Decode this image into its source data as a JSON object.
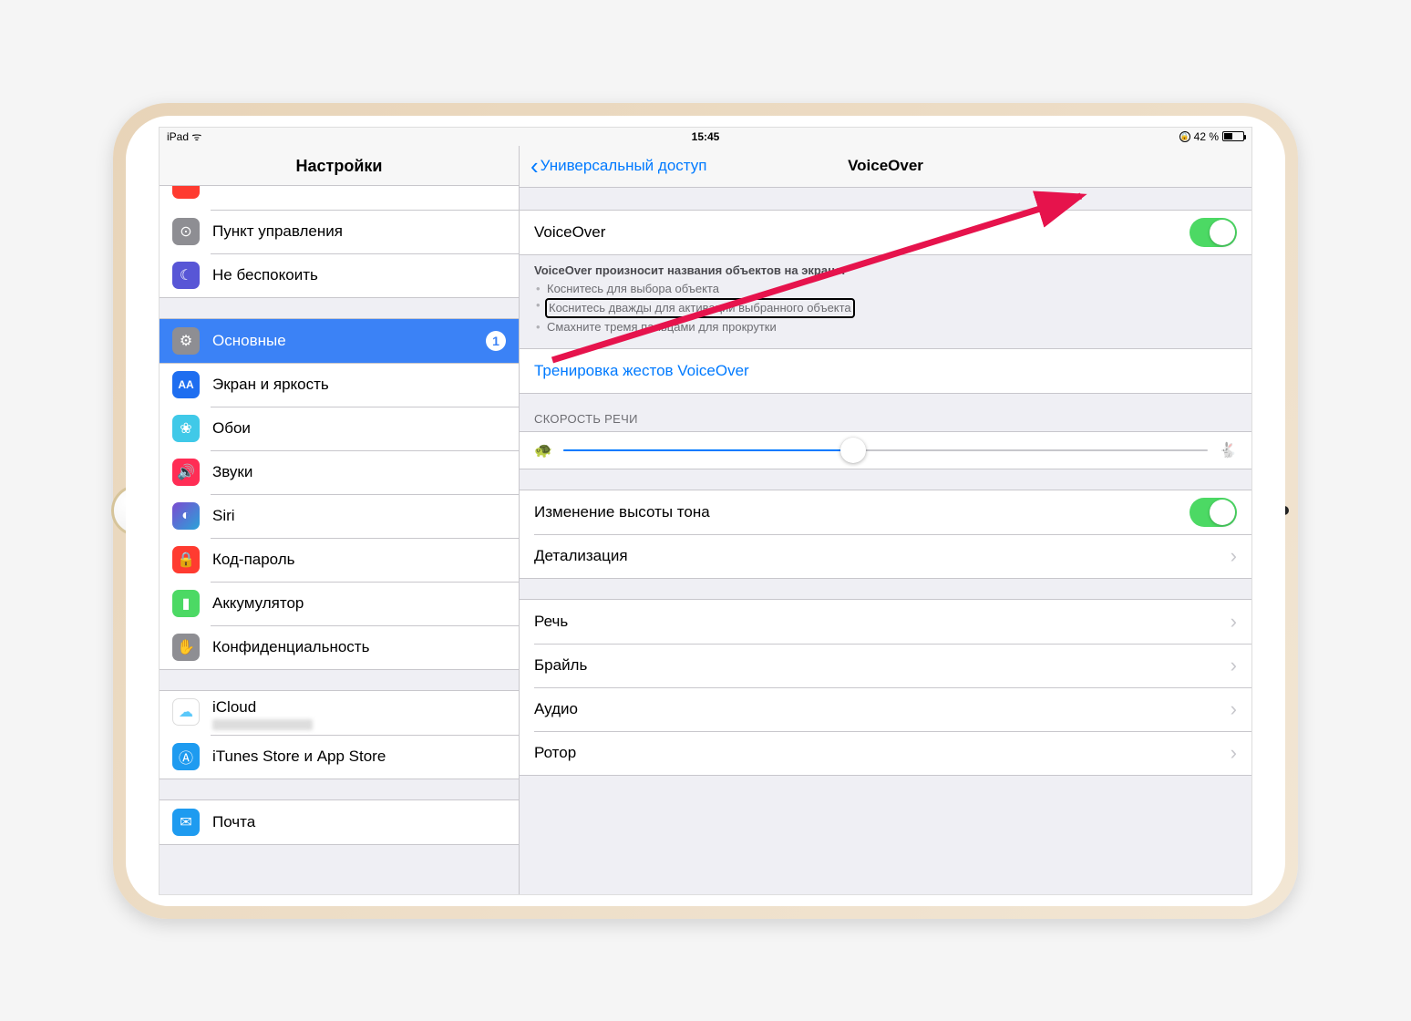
{
  "status": {
    "device": "iPad",
    "time": "15:45",
    "battery": "42 %"
  },
  "sidebar": {
    "title": "Настройки",
    "items": [
      {
        "label": "Пункт управления",
        "icon_bg": "#8e8e93",
        "glyph": "⊙"
      },
      {
        "label": "Не беспокоить",
        "icon_bg": "#5856d6",
        "glyph": "☾"
      },
      {
        "label": "Основные",
        "icon_bg": "#8e8e93",
        "glyph": "⚙",
        "selected": true,
        "badge": "1"
      },
      {
        "label": "Экран и яркость",
        "icon_bg": "#1e6ef0",
        "glyph": "AA"
      },
      {
        "label": "Обои",
        "icon_bg": "#40c9e8",
        "glyph": "❀"
      },
      {
        "label": "Звуки",
        "icon_bg": "#ff2d55",
        "glyph": "🔊"
      },
      {
        "label": "Siri",
        "icon_bg": "#000",
        "glyph": "◐"
      },
      {
        "label": "Код-пароль",
        "icon_bg": "#ff3b30",
        "glyph": "🔒"
      },
      {
        "label": "Аккумулятор",
        "icon_bg": "#4cd964",
        "glyph": "▮"
      },
      {
        "label": "Конфиденциальность",
        "icon_bg": "#8e8e93",
        "glyph": "✋"
      },
      {
        "label": "iCloud",
        "icon_bg": "#fff",
        "glyph": "☁"
      },
      {
        "label": "iTunes Store и App Store",
        "icon_bg": "#1e9bf0",
        "glyph": "Ⓐ"
      },
      {
        "label": "Почта",
        "icon_bg": "#1e9bf0",
        "glyph": "✉"
      }
    ]
  },
  "detail": {
    "back": "Универсальный доступ",
    "title": "VoiceOver",
    "voiceover_label": "VoiceOver",
    "note_title": "VoiceOver произносит названия объектов на экране:",
    "note_bullets": [
      "Коснитесь для выбора объекта",
      "Коснитесь дважды для активации выбранного объекта",
      "Смахните тремя пальцами для прокрутки"
    ],
    "practice": "Тренировка жестов VoiceOver",
    "speed_header": "СКОРОСТЬ РЕЧИ",
    "speed_value": 45,
    "pitch_label": "Изменение высоты тона",
    "verbosity_label": "Детализация",
    "speech_label": "Речь",
    "braille_label": "Брайль",
    "audio_label": "Аудио",
    "rotor_label": "Ротор"
  }
}
